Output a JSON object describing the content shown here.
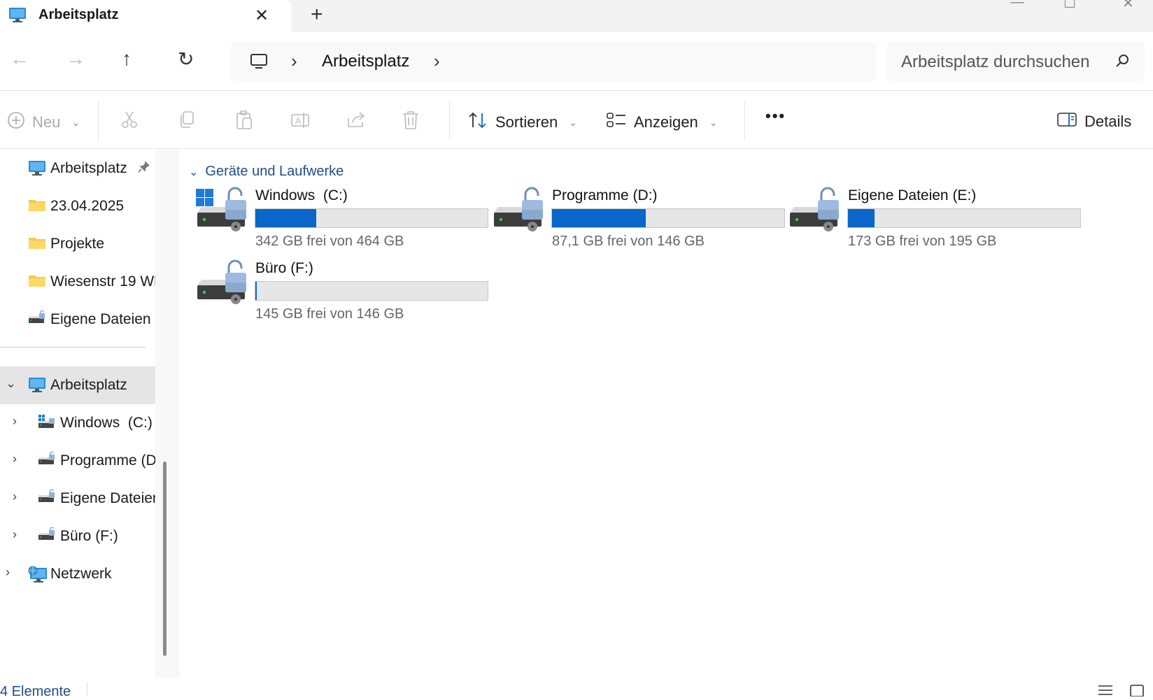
{
  "window": {
    "tab_title": "Arbeitsplatz",
    "new_tab_label": "+",
    "close_tab_label": "✕"
  },
  "navigation": {
    "back": "←",
    "forward": "→",
    "up": "↑",
    "refresh": "↻",
    "breadcrumb_separator": "›",
    "breadcrumb": [
      "Arbeitsplatz"
    ],
    "search_placeholder": "Arbeitsplatz durchsuchen"
  },
  "toolbar": {
    "new_label": "Neu",
    "sort_label": "Sortieren",
    "view_label": "Anzeigen",
    "more_label": "•••",
    "details_label": "Details"
  },
  "sidebar": {
    "quick_access": [
      {
        "label": "Arbeitsplatz",
        "icon": "monitor-icon",
        "pinned": true
      },
      {
        "label": "23.04.2025",
        "icon": "folder-icon"
      },
      {
        "label": "Projekte",
        "icon": "folder-icon"
      },
      {
        "label": "Wiesenstr 19 Wh",
        "icon": "folder-icon"
      },
      {
        "label": "Eigene Dateien (",
        "icon": "drive-icon"
      }
    ],
    "tree": {
      "root_label": "Arbeitsplatz",
      "children": [
        {
          "label": "Windows  (C:)",
          "icon": "windows-drive-icon"
        },
        {
          "label": "Programme (D",
          "icon": "drive-icon"
        },
        {
          "label": "Eigene Dateien",
          "icon": "drive-icon"
        },
        {
          "label": "Büro (F:)",
          "icon": "drive-icon"
        }
      ],
      "network_label": "Netzwerk"
    }
  },
  "main": {
    "group_title": "Geräte und Laufwerke",
    "drives": [
      {
        "name": "Windows  (C:)",
        "info": "342 GB frei von 464 GB",
        "used_fraction": 0.263,
        "windows": true
      },
      {
        "name": "Programme (D:)",
        "info": "87,1 GB frei von 146 GB",
        "used_fraction": 0.403
      },
      {
        "name": "Eigene Dateien (E:)",
        "info": "173 GB frei von 195 GB",
        "used_fraction": 0.113
      },
      {
        "name": "Büro (F:)",
        "info": "145 GB frei von 146 GB",
        "used_fraction": 0.007
      }
    ]
  },
  "status": {
    "count": "4 Elemente"
  },
  "colors": {
    "accent": "#0a66c8",
    "link": "#1f4e8c",
    "selected": "#e5e5e5"
  }
}
